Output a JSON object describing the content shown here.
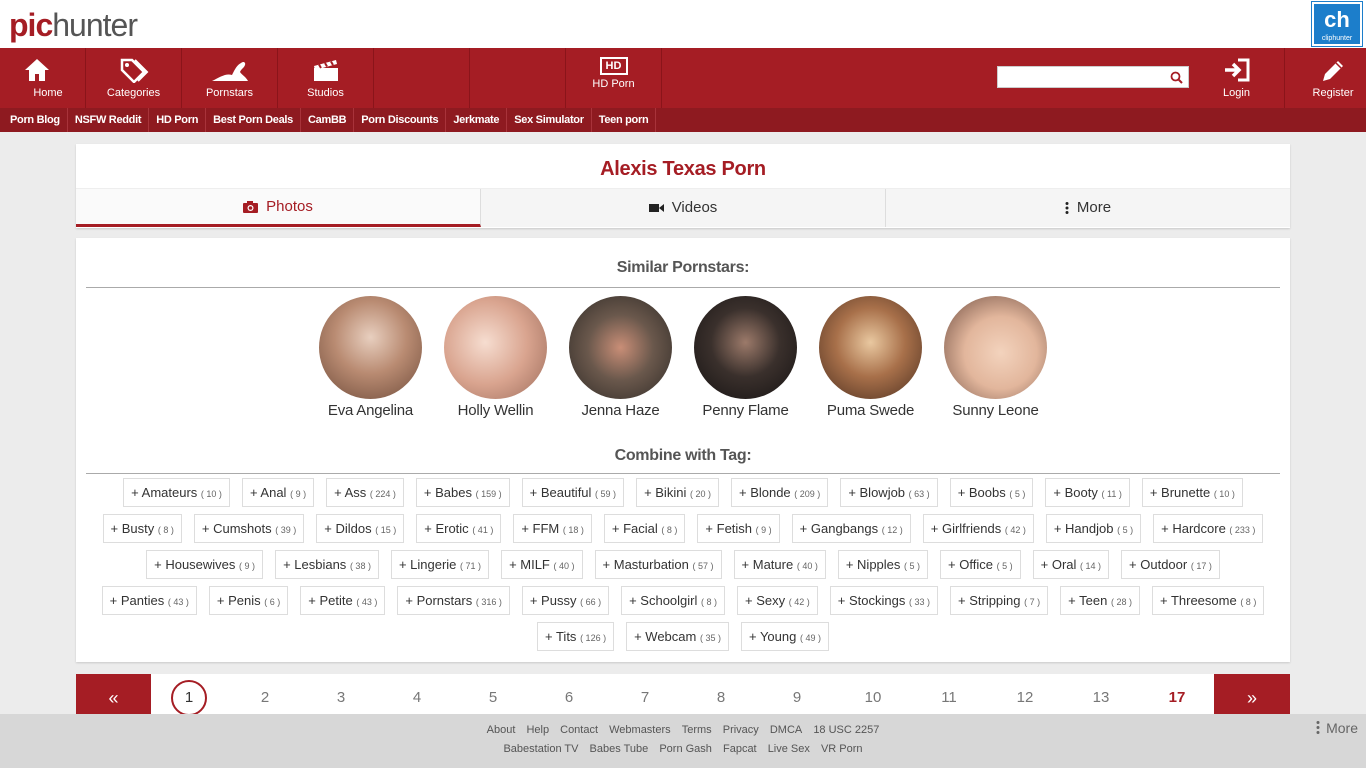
{
  "brand": {
    "pic": "pic",
    "hunter": "hunter",
    "clip_badge": "ch",
    "clip_sub": "cliphunter"
  },
  "nav": {
    "home": "Home",
    "categories": "Categories",
    "pornstars": "Pornstars",
    "studios": "Studios",
    "hd": "HD Porn",
    "hd_badge": "HD",
    "login": "Login",
    "register": "Register"
  },
  "search": {
    "placeholder": "",
    "value": ""
  },
  "subnav": [
    "Porn Blog",
    "NSFW Reddit",
    "HD Porn",
    "Best Porn Deals",
    "CamBB",
    "Porn Discounts",
    "Jerkmate",
    "Sex Simulator",
    "Teen porn"
  ],
  "page_title": "Alexis Texas Porn",
  "tabs": {
    "photos": "Photos",
    "videos": "Videos",
    "more": "More"
  },
  "similar": {
    "title": "Similar Pornstars:",
    "stars": [
      {
        "name": "Eva Angelina",
        "color": "#b98b72"
      },
      {
        "name": "Holly Wellin",
        "color": "#d9a48f"
      },
      {
        "name": "Jenna Haze",
        "color": "#4a4038"
      },
      {
        "name": "Penny Flame",
        "color": "#2c2624"
      },
      {
        "name": "Puma Swede",
        "color": "#8a5a3a"
      },
      {
        "name": "Sunny Leone",
        "color": "#e2b69c"
      }
    ]
  },
  "combine": {
    "title": "Combine with Tag:",
    "tags": [
      {
        "label": "+ Amateurs",
        "count": "( 10 )"
      },
      {
        "label": "+ Anal",
        "count": "( 9 )"
      },
      {
        "label": "+ Ass",
        "count": "( 224 )"
      },
      {
        "label": "+ Babes",
        "count": "( 159 )"
      },
      {
        "label": "+ Beautiful",
        "count": "( 59 )"
      },
      {
        "label": "+ Bikini",
        "count": "( 20 )"
      },
      {
        "label": "+ Blonde",
        "count": "( 209 )"
      },
      {
        "label": "+ Blowjob",
        "count": "( 63 )"
      },
      {
        "label": "+ Boobs",
        "count": "( 5 )"
      },
      {
        "label": "+ Booty",
        "count": "( 11 )"
      },
      {
        "label": "+ Brunette",
        "count": "( 10 )"
      },
      {
        "label": "+ Busty",
        "count": "( 8 )"
      },
      {
        "label": "+ Cumshots",
        "count": "( 39 )"
      },
      {
        "label": "+ Dildos",
        "count": "( 15 )"
      },
      {
        "label": "+ Erotic",
        "count": "( 41 )"
      },
      {
        "label": "+ FFM",
        "count": "( 18 )"
      },
      {
        "label": "+ Facial",
        "count": "( 8 )"
      },
      {
        "label": "+ Fetish",
        "count": "( 9 )"
      },
      {
        "label": "+ Gangbangs",
        "count": "( 12 )"
      },
      {
        "label": "+ Girlfriends",
        "count": "( 42 )"
      },
      {
        "label": "+ Handjob",
        "count": "( 5 )"
      },
      {
        "label": "+ Hardcore",
        "count": "( 233 )"
      },
      {
        "label": "+ Housewives",
        "count": "( 9 )"
      },
      {
        "label": "+ Lesbians",
        "count": "( 38 )"
      },
      {
        "label": "+ Lingerie",
        "count": "( 71 )"
      },
      {
        "label": "+ MILF",
        "count": "( 40 )"
      },
      {
        "label": "+ Masturbation",
        "count": "( 57 )"
      },
      {
        "label": "+ Mature",
        "count": "( 40 )"
      },
      {
        "label": "+ Nipples",
        "count": "( 5 )"
      },
      {
        "label": "+ Office",
        "count": "( 5 )"
      },
      {
        "label": "+ Oral",
        "count": "( 14 )"
      },
      {
        "label": "+ Outdoor",
        "count": "( 17 )"
      },
      {
        "label": "+ Panties",
        "count": "( 43 )"
      },
      {
        "label": "+ Penis",
        "count": "( 6 )"
      },
      {
        "label": "+ Petite",
        "count": "( 43 )"
      },
      {
        "label": "+ Pornstars",
        "count": "( 316 )"
      },
      {
        "label": "+ Pussy",
        "count": "( 66 )"
      },
      {
        "label": "+ Schoolgirl",
        "count": "( 8 )"
      },
      {
        "label": "+ Sexy",
        "count": "( 42 )"
      },
      {
        "label": "+ Stockings",
        "count": "( 33 )"
      },
      {
        "label": "+ Stripping",
        "count": "( 7 )"
      },
      {
        "label": "+ Teen",
        "count": "( 28 )"
      },
      {
        "label": "+ Threesome",
        "count": "( 8 )"
      },
      {
        "label": "+ Tits",
        "count": "( 126 )"
      },
      {
        "label": "+ Webcam",
        "count": "( 35 )"
      },
      {
        "label": "+ Young",
        "count": "( 49 )"
      }
    ]
  },
  "pagination": {
    "prev": "«",
    "next": "»",
    "current": "1",
    "pages": [
      "2",
      "3",
      "4",
      "5",
      "6",
      "7",
      "8",
      "9",
      "10",
      "11",
      "12",
      "13"
    ],
    "last": "17"
  },
  "footer": {
    "row1": [
      "About",
      "Help",
      "Contact",
      "Webmasters",
      "Terms",
      "Privacy",
      "DMCA",
      "18 USC 2257"
    ],
    "row2": [
      "Babestation TV",
      "Babes Tube",
      "Porn Gash",
      "Fapcat",
      "Live Sex",
      "VR Porn"
    ],
    "more": "More"
  },
  "colors": {
    "brand_red": "#a51d24",
    "subnav_red": "#8e1a20",
    "clip_blue": "#1c7ecb"
  }
}
